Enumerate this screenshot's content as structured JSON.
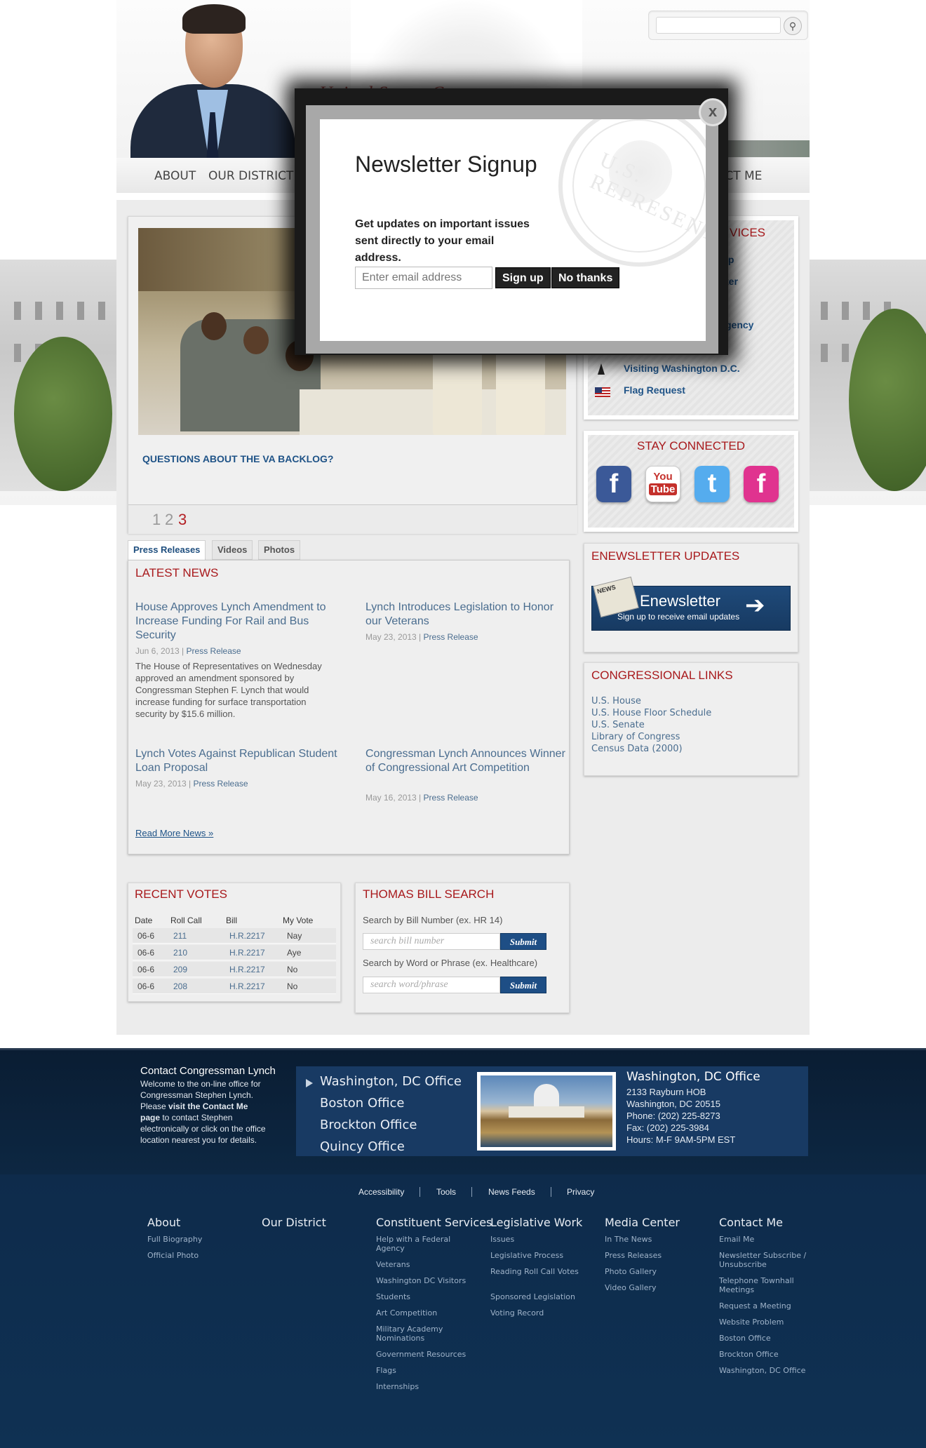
{
  "header": {
    "tagline": "United States Congressman",
    "nav": [
      "ABOUT",
      "OUR DISTRICT",
      "ACT ME"
    ]
  },
  "slider": {
    "caption": "QUESTIONS ABOUT THE VA BACKLOG?",
    "pages": [
      "1",
      "2",
      "3"
    ],
    "active_page": "3"
  },
  "news_tabs": [
    "Press Releases",
    "Videos",
    "Photos"
  ],
  "latest_news": {
    "heading": "LATEST NEWS",
    "items": [
      {
        "title": "House Approves Lynch Amendment to Increase Funding For Rail and Bus Security",
        "date": "Jun 6, 2013",
        "type": "Press Release",
        "desc": "The House of Representatives on Wednesday approved an amendment sponsored by Congressman Stephen F. Lynch that would increase funding for surface transportation security by $15.6 million."
      },
      {
        "title": "Lynch Introduces Legislation to Honor our Veterans",
        "date": "May 23, 2013",
        "type": "Press Release"
      },
      {
        "title": "Lynch Votes Against Republican Student Loan Proposal",
        "date": "May 23, 2013",
        "type": "Press Release"
      },
      {
        "title": "Congressman Lynch Announces Winner of Congressional Art Competition",
        "date": "May 16, 2013",
        "type": "Press Release"
      }
    ],
    "read_more": "Read More News »"
  },
  "recent_votes": {
    "heading": "RECENT VOTES",
    "columns": [
      "Date",
      "Roll Call",
      "Bill",
      "My Vote"
    ],
    "rows": [
      [
        "06-6",
        "211",
        "H.R.2217",
        "Nay"
      ],
      [
        "06-6",
        "210",
        "H.R.2217",
        "Aye"
      ],
      [
        "06-6",
        "209",
        "H.R.2217",
        "No"
      ],
      [
        "06-6",
        "208",
        "H.R.2217",
        "No"
      ]
    ]
  },
  "thomas": {
    "heading": "THOMAS BILL SEARCH",
    "label1": "Search by Bill Number (ex. HR 14)",
    "placeholder1": "search bill number",
    "label2": "Search by Word or Phrase (ex. Healthcare)",
    "placeholder2": "search word/phrase",
    "submit": "Submit"
  },
  "services": {
    "heading_visible": "VICES",
    "items": [
      "ip",
      "ter",
      "gency",
      "Visiting Washington D.C.",
      "Flag Request"
    ]
  },
  "stay_connected": {
    "heading": "STAY CONNECTED",
    "icons": [
      {
        "name": "facebook-icon",
        "glyph": "f",
        "color": "#3b5998"
      },
      {
        "name": "youtube-icon",
        "glyph": "You Tube",
        "color": "#c4302b"
      },
      {
        "name": "twitter-icon",
        "glyph": "t",
        "color": "#55acee"
      },
      {
        "name": "facebook-pink-icon",
        "glyph": "f",
        "color": "#e0338f"
      }
    ]
  },
  "enewsletter": {
    "heading": "ENEWSLETTER UPDATES",
    "banner_title": "Enewsletter",
    "banner_sub": "Sign up to receive email updates",
    "paper_label": "NEWS"
  },
  "congressional_links": {
    "heading": "CONGRESSIONAL LINKS",
    "items": [
      "U.S. House",
      "U.S. House Floor Schedule",
      "U.S. Senate",
      "Library of Congress",
      "Census Data (2000)"
    ]
  },
  "modal": {
    "title": "Newsletter Signup",
    "body": "Get updates on important issues sent directly to your email address.",
    "email_placeholder": "Enter email address",
    "signup": "Sign up",
    "no_thanks": "No thanks",
    "close": "x",
    "seal_text": "U.S. REPRESENTATIVES"
  },
  "footer": {
    "contact_title": "Contact Congressman Lynch",
    "contact_text_1": "Welcome to the on-line office for Congressman Stephen Lynch. Please ",
    "contact_link": "visit the Contact Me page",
    "contact_text_2": " to contact Stephen electronically or click on the office location nearest you for details.",
    "offices": [
      "Washington, DC Office",
      "Boston Office",
      "Brockton Office",
      "Quincy Office"
    ],
    "office_detail": {
      "name": "Washington, DC Office",
      "address1": "2133 Rayburn HOB",
      "address2": "Washington, DC 20515",
      "phone": "Phone: (202) 225-8273",
      "fax": "Fax: (202) 225-3984",
      "hours": "Hours: M-F 9AM-5PM EST"
    },
    "utility": [
      "Accessibility",
      "Tools",
      "News Feeds",
      "Privacy"
    ],
    "columns": [
      {
        "title": "About",
        "items": [
          "Full Biography",
          "Official Photo"
        ]
      },
      {
        "title": "Our District",
        "items": []
      },
      {
        "title": "Constituent Services",
        "items": [
          "Help with a Federal Agency",
          "Veterans",
          "Washington DC Visitors",
          "Students",
          "Art Competition",
          "Military Academy Nominations",
          "Government Resources",
          "Flags",
          "Internships"
        ]
      },
      {
        "title": "Legislative Work",
        "items": [
          "Issues",
          "Legislative Process",
          "Reading Roll Call Votes",
          "Sponsored Legislation",
          "Voting Record"
        ]
      },
      {
        "title": "Media Center",
        "items": [
          "In The News",
          "Press Releases",
          "Photo Gallery",
          "Video Gallery"
        ]
      },
      {
        "title": "Contact Me",
        "items": [
          "Email Me",
          "Newsletter Subscribe / Unsubscribe",
          "Telephone Townhall Meetings",
          "Request a Meeting",
          "Website Problem",
          "Boston Office",
          "Brockton Office",
          "Washington, DC Office"
        ]
      }
    ]
  }
}
